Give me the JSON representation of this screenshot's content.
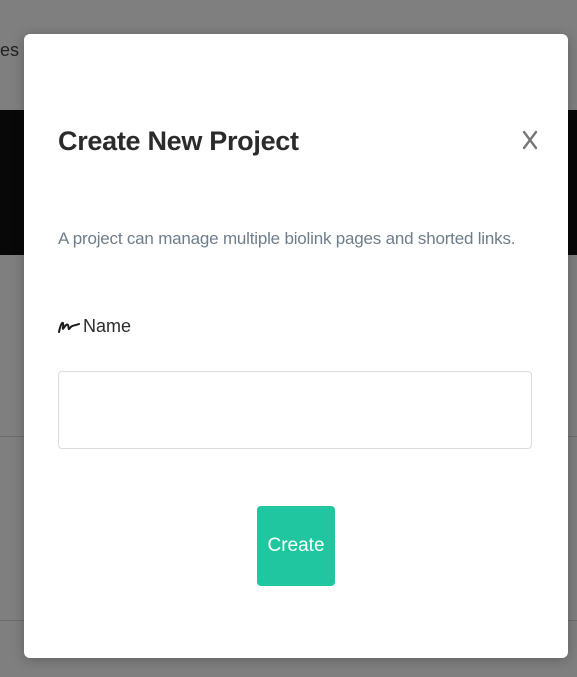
{
  "background": {
    "peek_text": "es"
  },
  "modal": {
    "title": "Create New Project",
    "close_label": "",
    "description": "A project can manage multiple biolink pages and shorted links.",
    "field": {
      "icon": "signature-icon",
      "label": "Name",
      "value": "",
      "placeholder": ""
    },
    "create_label": "Create"
  },
  "colors": {
    "accent": "#20c6a0",
    "description_text": "#6e7d8a",
    "title_text": "#2b2b2b"
  }
}
